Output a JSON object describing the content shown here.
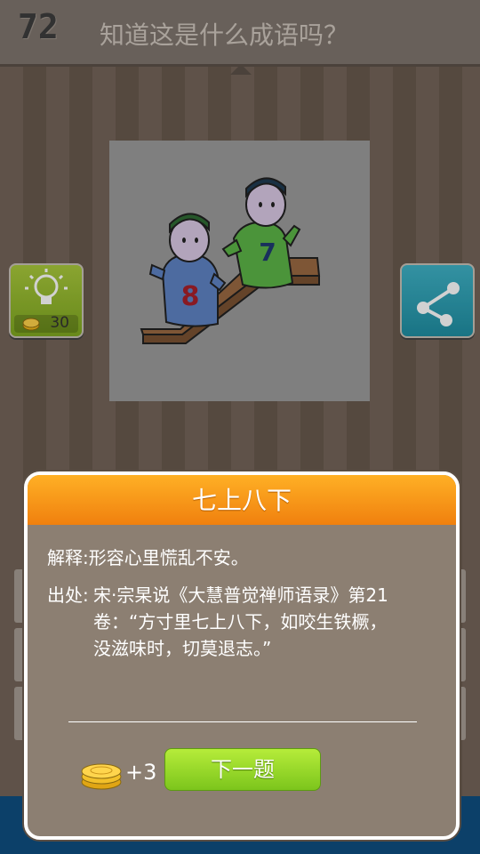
{
  "header": {
    "level": "72",
    "question": "知道这是什么成语吗？"
  },
  "picture": {
    "shirt_left_number": "8",
    "shirt_right_number": "7"
  },
  "hint": {
    "cost": "30",
    "icon": "lightbulb-icon"
  },
  "share": {
    "icon": "share-icon"
  },
  "dialog": {
    "title": "七上八下",
    "explanation": "解释:形容心里慌乱不安。",
    "source_label": "出处:",
    "source_lines": [
      "宋·宗杲说《大慧普觉禅师语录》第21",
      "卷：“方寸里七上八下，如咬生铁橛，",
      "没滋味时，切莫退志。”"
    ],
    "reward": "+3",
    "next_label": "下一题"
  },
  "colors": {
    "header_orange": "#f0800e",
    "next_green": "#7cc51c",
    "hint_green": "#a9c93c",
    "share_blue": "#1f8ea2"
  }
}
